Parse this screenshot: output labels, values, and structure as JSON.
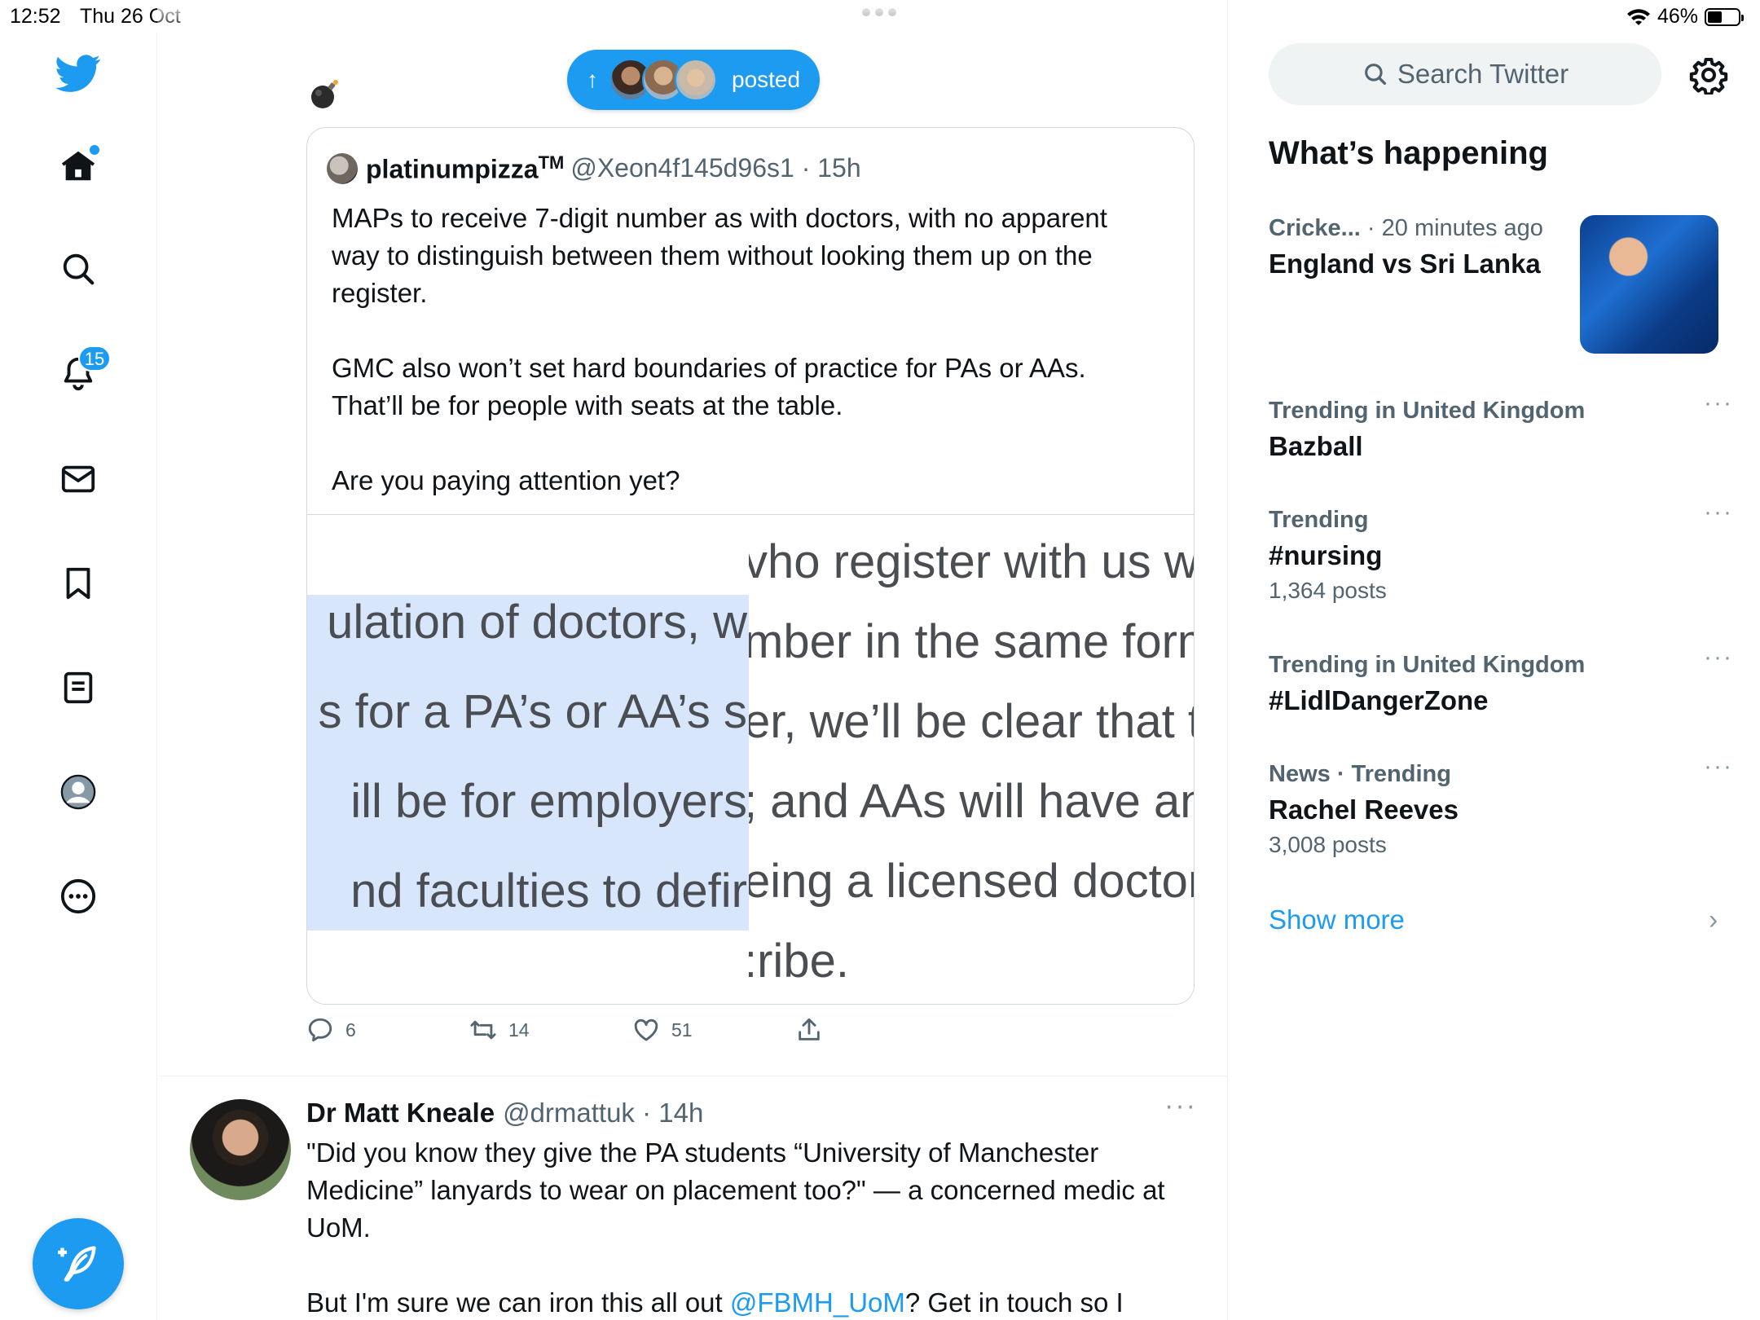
{
  "status_bar": {
    "time": "12:52",
    "date": "Thu 26 Oct",
    "battery": "46%"
  },
  "nav": {
    "notifications_badge": "15"
  },
  "timeline": {
    "new_posts_pill": {
      "label": "posted"
    },
    "quote": {
      "name": "platinumpizza",
      "tm": "TM",
      "handle": "@Xeon4f145d96s1",
      "time": "15h",
      "text": "MAPs to receive 7-digit number as with doctors, with no apparent way to distinguish between them without looking them up on the register.\n\nGMC also won’t set hard boundaries of practice for PAs or AAs. That’ll be for people with seats at the table.\n\nAre you paying attention yet?",
      "image_left_lines": [
        "ulation of doctors, w",
        "s for a PA’s or AA’s s",
        "ill be for employers",
        "nd faculties to defir"
      ],
      "image_right_lines": [
        "vho register with us wi",
        "mber in the same form",
        "er, we’ll be clear that tl",
        "; and AAs will have any",
        "eing a licensed doctor,",
        ":ribe."
      ]
    },
    "actions": {
      "replies": "6",
      "reposts": "14",
      "likes": "51"
    },
    "tweet2": {
      "name": "Dr Matt Kneale",
      "handle": "@drmattuk",
      "time": "14h",
      "text_before": "\"Did you know they give the PA students “University of Manchester Medicine” lanyards to wear on placement too?\" — a concerned medic at UoM.\n\nBut I'm sure we can iron this all out ",
      "mention": "@FBMH_UoM",
      "text_after": "? Get in touch so I"
    }
  },
  "sidebar": {
    "search_placeholder": "Search Twitter",
    "whats_happening": "What’s happening",
    "trends": [
      {
        "context": "Cricke...",
        "meta": "20 minutes ago",
        "topic": "England vs Sri Lanka",
        "count": ""
      },
      {
        "context": "Trending in United Kingdom",
        "meta": "",
        "topic": "Bazball",
        "count": ""
      },
      {
        "context": "Trending",
        "meta": "",
        "topic": "#nursing",
        "count": "1,364 posts"
      },
      {
        "context": "Trending in United Kingdom",
        "meta": "",
        "topic": "#LidlDangerZone",
        "count": ""
      },
      {
        "context": "News · Trending",
        "meta": "",
        "topic": "Rachel Reeves",
        "count": "3,008 posts"
      }
    ],
    "show_more": "Show more"
  },
  "icons": {
    "nav": [
      "twitter-logo-icon",
      "home-icon",
      "search-icon",
      "bell-icon",
      "mail-icon",
      "bookmark-icon",
      "lists-icon",
      "profile-icon",
      "more-icon"
    ],
    "actions": [
      "reply-icon",
      "retweet-icon",
      "like-icon",
      "share-icon"
    ]
  },
  "colors": {
    "accent": "#1d9bf0",
    "text": "#0f1419",
    "muted": "#536471",
    "selection": "#d7e6fb"
  }
}
